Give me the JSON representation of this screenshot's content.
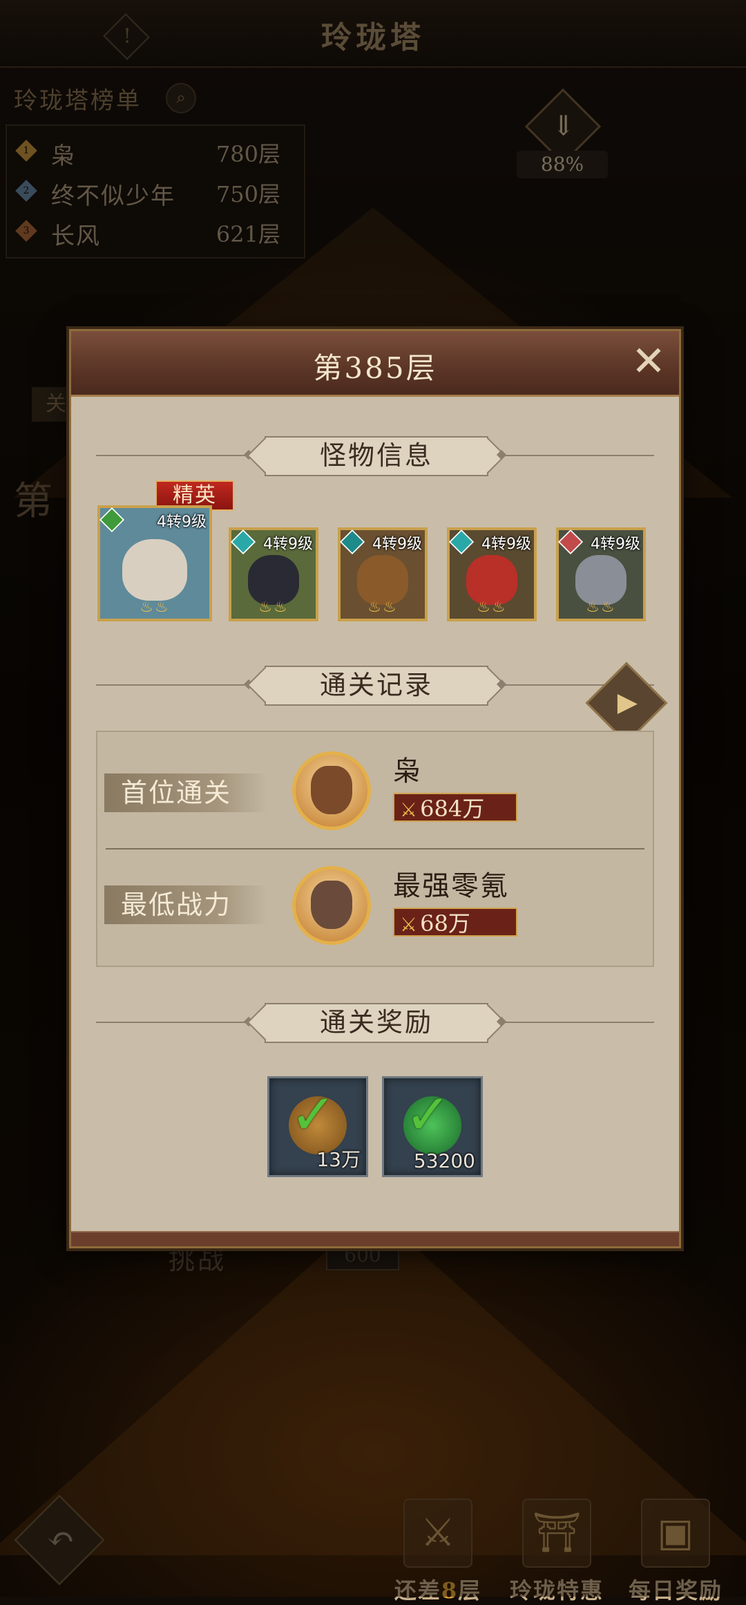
{
  "header": {
    "title": "玲珑塔",
    "info_glyph": "!"
  },
  "leaderboard": {
    "title": "玲珑塔榜单",
    "search_icon": "search-icon",
    "entries": [
      {
        "rank": "1",
        "name": "枭",
        "floor": "780层",
        "color": "#c9963e"
      },
      {
        "rank": "2",
        "name": "终不似少年",
        "floor": "750层",
        "color": "#6a8aa8"
      },
      {
        "rank": "3",
        "name": "长风",
        "floor": "621层",
        "color": "#b06a3a"
      }
    ]
  },
  "progress": {
    "percent_label": "88%",
    "percent": 88,
    "icon": "download-arrow-icon"
  },
  "behind": {
    "partial_label": "关",
    "challenge_label": "挑战",
    "cost": "600",
    "big_char": "第"
  },
  "modal": {
    "title": "第385层",
    "close_glyph": "✕",
    "monster_section": "怪物信息",
    "elite_label": "精英",
    "monsters": [
      {
        "level": "4转9级",
        "elem_color": "#3e9a3a",
        "bg": "#5e8a9a",
        "face": "#d9cfc0",
        "stars": "♨♨"
      },
      {
        "level": "4转9级",
        "elem_color": "#2aa8a8",
        "bg": "#5a6a3a",
        "face": "#2a2a34",
        "stars": "♨♨"
      },
      {
        "level": "4转9级",
        "elem_color": "#1e8a8a",
        "bg": "#6a5030",
        "face": "#8a5a2a",
        "stars": "♨♨"
      },
      {
        "level": "4转9级",
        "elem_color": "#2aa8a8",
        "bg": "#5a4a30",
        "face": "#b83028",
        "stars": "♨♨"
      },
      {
        "level": "4转9级",
        "elem_color": "#c24a4a",
        "bg": "#4a5040",
        "face": "#8a8e96",
        "stars": "♨♨"
      }
    ],
    "record_section": "通关记录",
    "video_icon": "video-camera-icon",
    "records": [
      {
        "label": "首位通关",
        "name": "枭",
        "power": "684万",
        "face": "#7a4a2a"
      },
      {
        "label": "最低战力",
        "name": "最强零氪",
        "power": "68万",
        "face": "#6a4a3a"
      }
    ],
    "reward_section": "通关奖励",
    "rewards": [
      {
        "qty": "13万",
        "coin": "#9a6a2a",
        "icon": "copper-coin-icon"
      },
      {
        "qty": "53200",
        "coin": "#2a8a3a",
        "icon": "jade-orb-icon"
      }
    ]
  },
  "bottom_bar": {
    "back_icon": "back-arrow-icon",
    "items": [
      {
        "label_pre": "还差",
        "label_hl": "8",
        "label_post": "层",
        "icon": "sword-icon"
      },
      {
        "label": "玲珑特惠",
        "icon": "pagoda-icon"
      },
      {
        "label": "每日奖励",
        "icon": "chest-icon"
      }
    ]
  }
}
